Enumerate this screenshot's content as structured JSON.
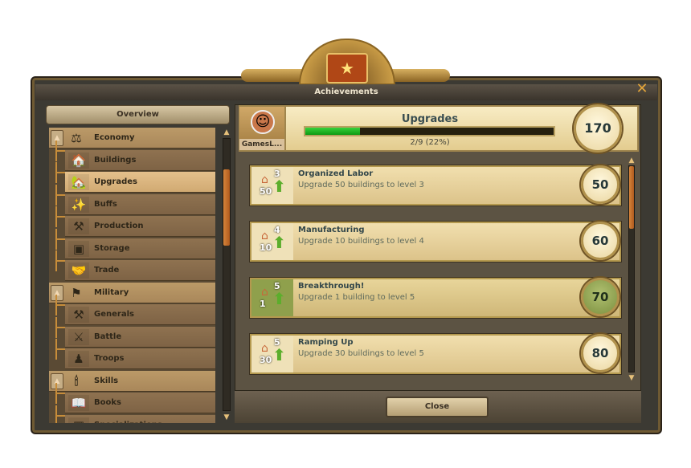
{
  "window": {
    "title": "Achievements",
    "close_icon": "✕"
  },
  "sidebar": {
    "overview_label": "Overview",
    "items": [
      {
        "label": "Economy",
        "type": "category",
        "icon": "scales-icon",
        "glyph": "⚖"
      },
      {
        "label": "Buildings",
        "type": "sub",
        "icon": "house-icon",
        "glyph": "🏠"
      },
      {
        "label": "Upgrades",
        "type": "sub",
        "icon": "house-plus-icon",
        "glyph": "🏡",
        "selected": true
      },
      {
        "label": "Buffs",
        "type": "sub",
        "icon": "sparkles-icon",
        "glyph": "✨"
      },
      {
        "label": "Production",
        "type": "sub",
        "icon": "tools-icon",
        "glyph": "⚒"
      },
      {
        "label": "Storage",
        "type": "sub",
        "icon": "chest-icon",
        "glyph": "▣"
      },
      {
        "label": "Trade",
        "type": "sub",
        "icon": "handshake-icon",
        "glyph": "🤝"
      },
      {
        "label": "Military",
        "type": "category",
        "icon": "banner-icon",
        "glyph": "⚑"
      },
      {
        "label": "Generals",
        "type": "sub",
        "icon": "anvil-icon",
        "glyph": "⚒"
      },
      {
        "label": "Battle",
        "type": "sub",
        "icon": "crossed-swords-icon",
        "glyph": "⚔"
      },
      {
        "label": "Troops",
        "type": "sub",
        "icon": "troops-icon",
        "glyph": "♟"
      },
      {
        "label": "Skills",
        "type": "category",
        "icon": "candle-icon",
        "glyph": "🕯"
      },
      {
        "label": "Books",
        "type": "sub",
        "icon": "book-icon",
        "glyph": "📖"
      },
      {
        "label": "Specializations",
        "type": "sub",
        "icon": "specializations-icon",
        "glyph": "▦"
      }
    ]
  },
  "header": {
    "player_name": "GamesL...",
    "title": "Upgrades",
    "progress_text": "2/9 (22%)",
    "progress": 0.22,
    "total_points": "170"
  },
  "achievements": [
    {
      "title": "Organized Labor",
      "description": "Upgrade 50 buildings to level 3",
      "count": "50",
      "level": "3",
      "points": "50",
      "completed": false
    },
    {
      "title": "Manufacturing",
      "description": "Upgrade 10 buildings to level 4",
      "count": "10",
      "level": "4",
      "points": "60",
      "completed": false
    },
    {
      "title": "Breakthrough!",
      "description": "Upgrade 1 building to level 5",
      "count": "1",
      "level": "5",
      "points": "70",
      "completed": true
    },
    {
      "title": "Ramping Up",
      "description": "Upgrade 30 buildings to level 5",
      "count": "30",
      "level": "5",
      "points": "80",
      "completed": false
    }
  ],
  "footer": {
    "close_label": "Close"
  }
}
